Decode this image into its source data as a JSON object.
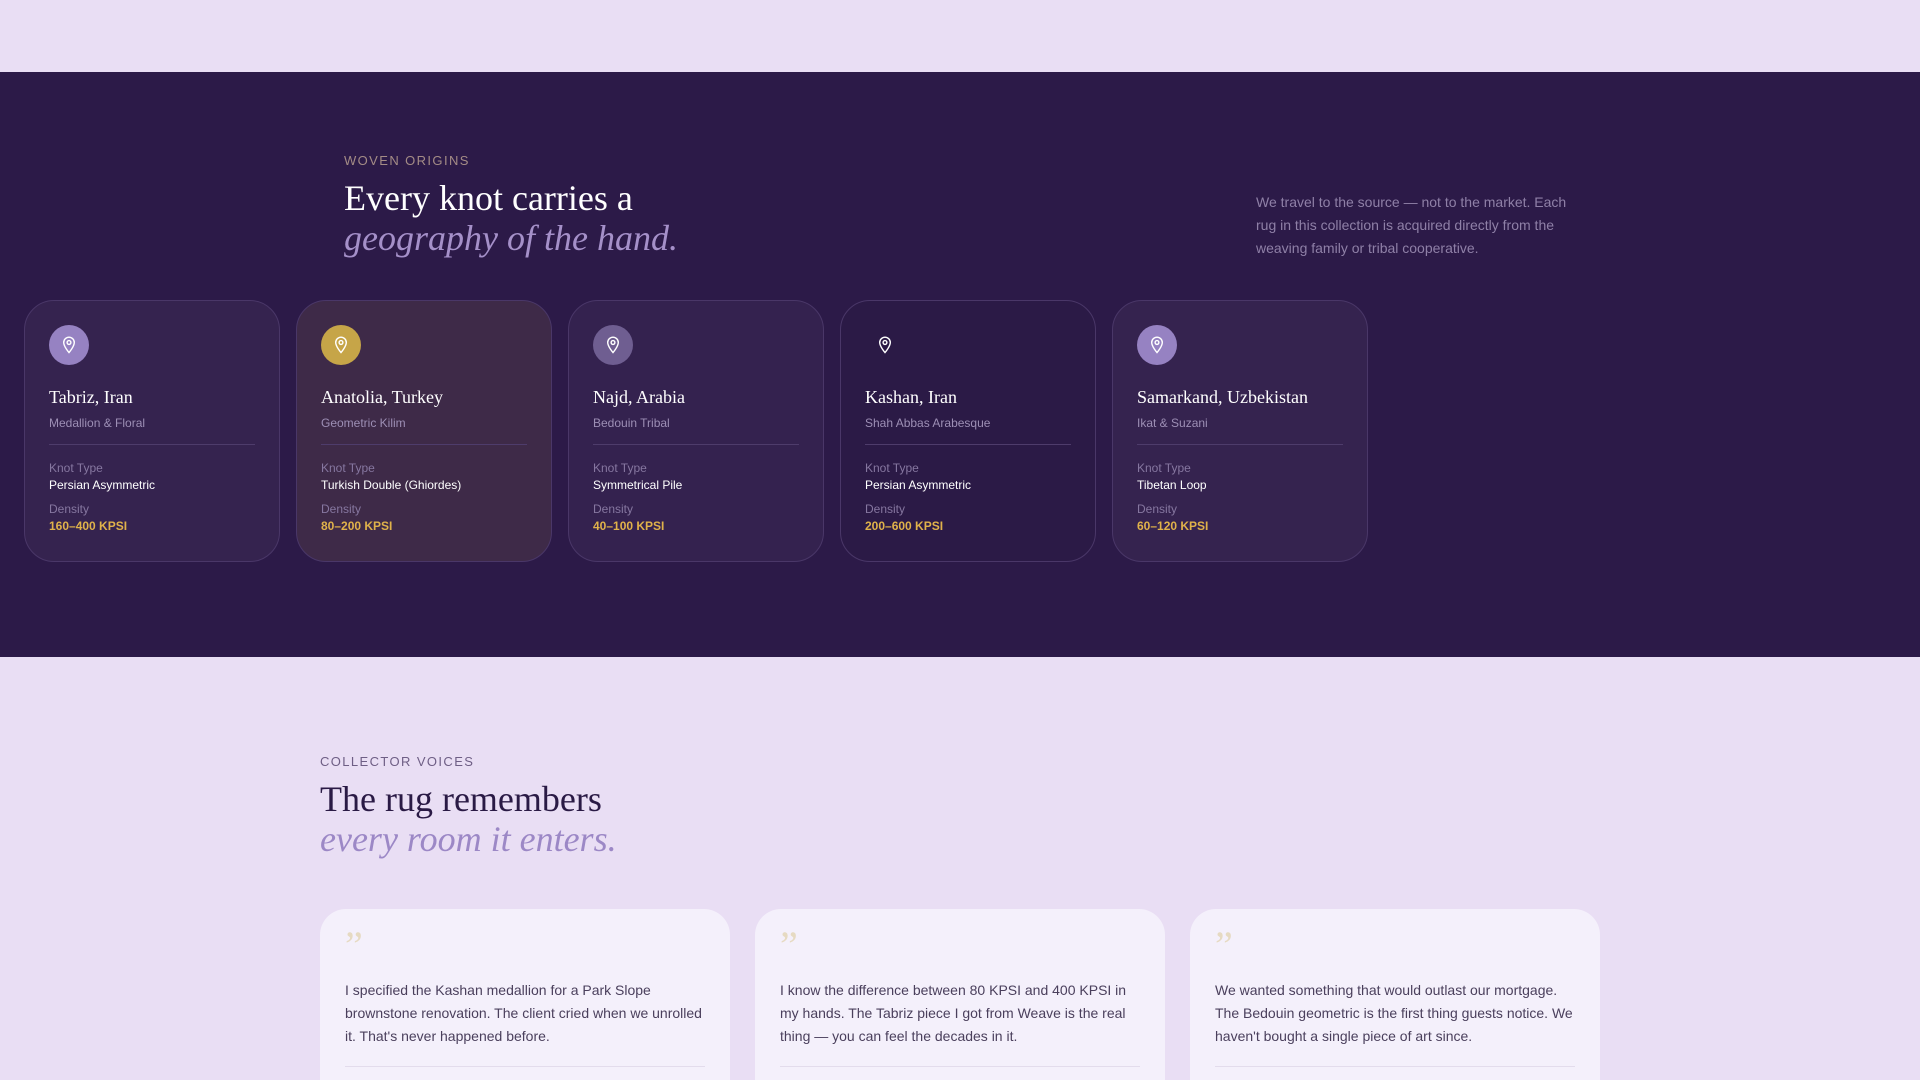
{
  "origins": {
    "eyebrow": "WOVEN ORIGINS",
    "title_line1": "Every knot carries a",
    "title_line2": "geography of the hand.",
    "lede": "We travel to the source — not to the market. Each rug in this collection is acquired directly from the weaving family or tribal cooperative.",
    "knot_label": "Knot Type",
    "density_label": "Density",
    "icon": "map-pin-icon",
    "cards": [
      {
        "city": "Tabriz, Iran",
        "style": "Medallion & Floral",
        "knot": "Persian Asymmetric",
        "density": "160–400 KPSI"
      },
      {
        "city": "Anatolia, Turkey",
        "style": "Geometric Kilim",
        "knot": "Turkish Double (Ghiordes)",
        "density": "80–200 KPSI"
      },
      {
        "city": "Najd, Arabia",
        "style": "Bedouin Tribal",
        "knot": "Symmetrical Pile",
        "density": "40–100 KPSI"
      },
      {
        "city": "Kashan, Iran",
        "style": "Shah Abbas Arabesque",
        "knot": "Persian Asymmetric",
        "density": "200–600 KPSI"
      },
      {
        "city": "Samarkand, Uzbekistan",
        "style": "Ikat & Suzani",
        "knot": "Tibetan Loop",
        "density": "60–120 KPSI"
      }
    ]
  },
  "voices": {
    "eyebrow": "COLLECTOR VOICES",
    "title_line1": "The rug remembers",
    "title_line2": "every room it enters.",
    "quote_mark": "”",
    "quotes": [
      "I specified the Kashan medallion for a Park Slope brownstone renovation. The client cried when we unrolled it. That's never happened before.",
      "I know the difference between 80 KPSI and 400 KPSI in my hands. The Tabriz piece I got from Weave is the real thing — you can feel the decades in it.",
      "We wanted something that would outlast our mortgage. The Bedouin geometric is the first thing guests notice. We haven't bought a single piece of art since."
    ]
  },
  "colors": {
    "section_dark": "#2c1a48",
    "page_light": "#e9def4",
    "accent_gold": "#e0b24a",
    "accent_lilac": "#a590c9"
  }
}
